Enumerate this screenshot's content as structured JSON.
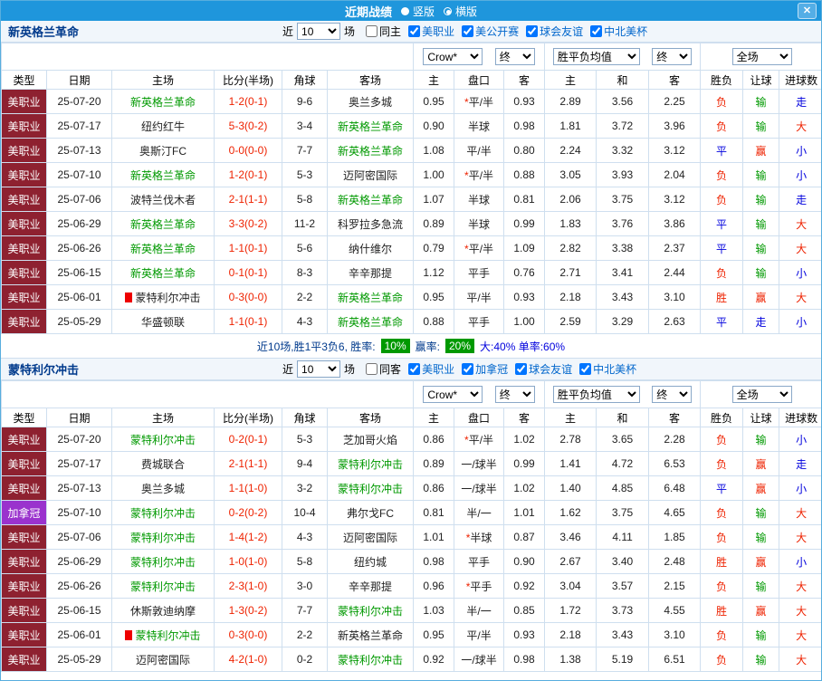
{
  "colors": {
    "topbar_bg": "#1f96dc",
    "league_mls_bg": "#8e2130",
    "league_can_bg": "#9a32cd",
    "focal_team_green": "#009900",
    "score_red": "#ee2200",
    "outcome_red": "#ee2200",
    "outcome_blue": "#0000dd",
    "outcome_green": "#009900",
    "summary_badge_bg": "#009900"
  },
  "top_bar": {
    "title": "近期战绩",
    "layout_options": [
      {
        "label": "竖版",
        "selected": false
      },
      {
        "label": "横版",
        "selected": true
      }
    ],
    "close_label": "✕"
  },
  "sections": [
    {
      "team": "新英格兰革命",
      "filter": {
        "prefix": "近",
        "count": "10",
        "suffix": "场",
        "checkboxes": [
          {
            "label": "同主",
            "checked": false,
            "blue": false
          },
          {
            "label": "美职业",
            "checked": true,
            "blue": true
          },
          {
            "label": "美公开赛",
            "checked": true,
            "blue": true
          },
          {
            "label": "球会友谊",
            "checked": true,
            "blue": true
          },
          {
            "label": "中北美杯",
            "checked": true,
            "blue": true
          }
        ]
      },
      "dropdowns": {
        "company": "Crow*",
        "company_state": "终",
        "avg_type": "胜平负均值",
        "avg_state": "终",
        "scope": "全场"
      },
      "headers": [
        "类型",
        "日期",
        "主场",
        "比分(半场)",
        "角球",
        "客场",
        "主",
        "盘口",
        "客",
        "主",
        "和",
        "客",
        "胜负",
        "让球",
        "进球数"
      ],
      "rows": [
        {
          "league": "美职业",
          "lt": "mls",
          "date": "25-07-20",
          "home": {
            "name": "新英格兰革命",
            "focal": true,
            "rc": false
          },
          "score": "1-2(0-1)",
          "corners": "9-6",
          "away": {
            "name": "奥兰多城",
            "focal": false,
            "rc": false
          },
          "o1": "0.95",
          "hc": "*平/半",
          "o2": "0.93",
          "a1": "2.89",
          "a2": "3.56",
          "a3": "2.25",
          "r1": "负",
          "r2": "输",
          "r3": "走"
        },
        {
          "league": "美职业",
          "lt": "mls",
          "date": "25-07-17",
          "home": {
            "name": "纽约红牛",
            "focal": false,
            "rc": false
          },
          "score": "5-3(0-2)",
          "corners": "3-4",
          "away": {
            "name": "新英格兰革命",
            "focal": true,
            "rc": false
          },
          "o1": "0.90",
          "hc": "半球",
          "o2": "0.98",
          "a1": "1.81",
          "a2": "3.72",
          "a3": "3.96",
          "r1": "负",
          "r2": "输",
          "r3": "大"
        },
        {
          "league": "美职业",
          "lt": "mls",
          "date": "25-07-13",
          "home": {
            "name": "奥斯汀FC",
            "focal": false,
            "rc": false
          },
          "score": "0-0(0-0)",
          "corners": "7-7",
          "away": {
            "name": "新英格兰革命",
            "focal": true,
            "rc": false
          },
          "o1": "1.08",
          "hc": "平/半",
          "o2": "0.80",
          "a1": "2.24",
          "a2": "3.32",
          "a3": "3.12",
          "r1": "平",
          "r2": "赢",
          "r3": "小"
        },
        {
          "league": "美职业",
          "lt": "mls",
          "date": "25-07-10",
          "home": {
            "name": "新英格兰革命",
            "focal": true,
            "rc": false
          },
          "score": "1-2(0-1)",
          "corners": "5-3",
          "away": {
            "name": "迈阿密国际",
            "focal": false,
            "rc": false
          },
          "o1": "1.00",
          "hc": "*平/半",
          "o2": "0.88",
          "a1": "3.05",
          "a2": "3.93",
          "a3": "2.04",
          "r1": "负",
          "r2": "输",
          "r3": "小"
        },
        {
          "league": "美职业",
          "lt": "mls",
          "date": "25-07-06",
          "home": {
            "name": "波特兰伐木者",
            "focal": false,
            "rc": false
          },
          "score": "2-1(1-1)",
          "corners": "5-8",
          "away": {
            "name": "新英格兰革命",
            "focal": true,
            "rc": false
          },
          "o1": "1.07",
          "hc": "半球",
          "o2": "0.81",
          "a1": "2.06",
          "a2": "3.75",
          "a3": "3.12",
          "r1": "负",
          "r2": "输",
          "r3": "走"
        },
        {
          "league": "美职业",
          "lt": "mls",
          "date": "25-06-29",
          "home": {
            "name": "新英格兰革命",
            "focal": true,
            "rc": false
          },
          "score": "3-3(0-2)",
          "corners": "11-2",
          "away": {
            "name": "科罗拉多急流",
            "focal": false,
            "rc": false
          },
          "o1": "0.89",
          "hc": "半球",
          "o2": "0.99",
          "a1": "1.83",
          "a2": "3.76",
          "a3": "3.86",
          "r1": "平",
          "r2": "输",
          "r3": "大"
        },
        {
          "league": "美职业",
          "lt": "mls",
          "date": "25-06-26",
          "home": {
            "name": "新英格兰革命",
            "focal": true,
            "rc": false
          },
          "score": "1-1(0-1)",
          "corners": "5-6",
          "away": {
            "name": "纳什维尔",
            "focal": false,
            "rc": false
          },
          "o1": "0.79",
          "hc": "*平/半",
          "o2": "1.09",
          "a1": "2.82",
          "a2": "3.38",
          "a3": "2.37",
          "r1": "平",
          "r2": "输",
          "r3": "大"
        },
        {
          "league": "美职业",
          "lt": "mls",
          "date": "25-06-15",
          "home": {
            "name": "新英格兰革命",
            "focal": true,
            "rc": false
          },
          "score": "0-1(0-1)",
          "corners": "8-3",
          "away": {
            "name": "辛辛那提",
            "focal": false,
            "rc": false
          },
          "o1": "1.12",
          "hc": "平手",
          "o2": "0.76",
          "a1": "2.71",
          "a2": "3.41",
          "a3": "2.44",
          "r1": "负",
          "r2": "输",
          "r3": "小"
        },
        {
          "league": "美职业",
          "lt": "mls",
          "date": "25-06-01",
          "home": {
            "name": "蒙特利尔冲击",
            "focal": false,
            "rc": true
          },
          "score": "0-3(0-0)",
          "corners": "2-2",
          "away": {
            "name": "新英格兰革命",
            "focal": true,
            "rc": false
          },
          "o1": "0.95",
          "hc": "平/半",
          "o2": "0.93",
          "a1": "2.18",
          "a2": "3.43",
          "a3": "3.10",
          "r1": "胜",
          "r2": "赢",
          "r3": "大"
        },
        {
          "league": "美职业",
          "lt": "mls",
          "date": "25-05-29",
          "home": {
            "name": "华盛顿联",
            "focal": false,
            "rc": false
          },
          "score": "1-1(0-1)",
          "corners": "4-3",
          "away": {
            "name": "新英格兰革命",
            "focal": true,
            "rc": false
          },
          "o1": "0.88",
          "hc": "平手",
          "o2": "1.00",
          "a1": "2.59",
          "a2": "3.29",
          "a3": "2.63",
          "r1": "平",
          "r2": "走",
          "r3": "小"
        }
      ],
      "summary": {
        "lead": "近10场,胜1平3负6, 胜率:",
        "win_rate": "10%",
        "mid": "赢率:",
        "handicap_rate": "20%",
        "tail": "大:40% 单率:60%"
      }
    },
    {
      "team": "蒙特利尔冲击",
      "filter": {
        "prefix": "近",
        "count": "10",
        "suffix": "场",
        "checkboxes": [
          {
            "label": "同客",
            "checked": false,
            "blue": false
          },
          {
            "label": "美职业",
            "checked": true,
            "blue": true
          },
          {
            "label": "加拿冠",
            "checked": true,
            "blue": true
          },
          {
            "label": "球会友谊",
            "checked": true,
            "blue": true
          },
          {
            "label": "中北美杯",
            "checked": true,
            "blue": true
          }
        ]
      },
      "dropdowns": {
        "company": "Crow*",
        "company_state": "终",
        "avg_type": "胜平负均值",
        "avg_state": "终",
        "scope": "全场"
      },
      "headers": [
        "类型",
        "日期",
        "主场",
        "比分(半场)",
        "角球",
        "客场",
        "主",
        "盘口",
        "客",
        "主",
        "和",
        "客",
        "胜负",
        "让球",
        "进球数"
      ],
      "rows": [
        {
          "league": "美职业",
          "lt": "mls",
          "date": "25-07-20",
          "home": {
            "name": "蒙特利尔冲击",
            "focal": true,
            "rc": false
          },
          "score": "0-2(0-1)",
          "corners": "5-3",
          "away": {
            "name": "芝加哥火焰",
            "focal": false,
            "rc": false
          },
          "o1": "0.86",
          "hc": "*平/半",
          "o2": "1.02",
          "a1": "2.78",
          "a2": "3.65",
          "a3": "2.28",
          "r1": "负",
          "r2": "输",
          "r3": "小"
        },
        {
          "league": "美职业",
          "lt": "mls",
          "date": "25-07-17",
          "home": {
            "name": "费城联合",
            "focal": false,
            "rc": false
          },
          "score": "2-1(1-1)",
          "corners": "9-4",
          "away": {
            "name": "蒙特利尔冲击",
            "focal": true,
            "rc": false
          },
          "o1": "0.89",
          "hc": "一/球半",
          "o2": "0.99",
          "a1": "1.41",
          "a2": "4.72",
          "a3": "6.53",
          "r1": "负",
          "r2": "赢",
          "r3": "走"
        },
        {
          "league": "美职业",
          "lt": "mls",
          "date": "25-07-13",
          "home": {
            "name": "奥兰多城",
            "focal": false,
            "rc": false
          },
          "score": "1-1(1-0)",
          "corners": "3-2",
          "away": {
            "name": "蒙特利尔冲击",
            "focal": true,
            "rc": false
          },
          "o1": "0.86",
          "hc": "一/球半",
          "o2": "1.02",
          "a1": "1.40",
          "a2": "4.85",
          "a3": "6.48",
          "r1": "平",
          "r2": "赢",
          "r3": "小"
        },
        {
          "league": "加拿冠",
          "lt": "can",
          "date": "25-07-10",
          "home": {
            "name": "蒙特利尔冲击",
            "focal": true,
            "rc": false
          },
          "score": "0-2(0-2)",
          "corners": "10-4",
          "away": {
            "name": "弗尔戈FC",
            "focal": false,
            "rc": false
          },
          "o1": "0.81",
          "hc": "半/一",
          "o2": "1.01",
          "a1": "1.62",
          "a2": "3.75",
          "a3": "4.65",
          "r1": "负",
          "r2": "输",
          "r3": "大"
        },
        {
          "league": "美职业",
          "lt": "mls",
          "date": "25-07-06",
          "home": {
            "name": "蒙特利尔冲击",
            "focal": true,
            "rc": false
          },
          "score": "1-4(1-2)",
          "corners": "4-3",
          "away": {
            "name": "迈阿密国际",
            "focal": false,
            "rc": false
          },
          "o1": "1.01",
          "hc": "*半球",
          "o2": "0.87",
          "a1": "3.46",
          "a2": "4.11",
          "a3": "1.85",
          "r1": "负",
          "r2": "输",
          "r3": "大"
        },
        {
          "league": "美职业",
          "lt": "mls",
          "date": "25-06-29",
          "home": {
            "name": "蒙特利尔冲击",
            "focal": true,
            "rc": false
          },
          "score": "1-0(1-0)",
          "corners": "5-8",
          "away": {
            "name": "纽约城",
            "focal": false,
            "rc": false
          },
          "o1": "0.98",
          "hc": "平手",
          "o2": "0.90",
          "a1": "2.67",
          "a2": "3.40",
          "a3": "2.48",
          "r1": "胜",
          "r2": "赢",
          "r3": "小"
        },
        {
          "league": "美职业",
          "lt": "mls",
          "date": "25-06-26",
          "home": {
            "name": "蒙特利尔冲击",
            "focal": true,
            "rc": false
          },
          "score": "2-3(1-0)",
          "corners": "3-0",
          "away": {
            "name": "辛辛那提",
            "focal": false,
            "rc": false
          },
          "o1": "0.96",
          "hc": "*平手",
          "o2": "0.92",
          "a1": "3.04",
          "a2": "3.57",
          "a3": "2.15",
          "r1": "负",
          "r2": "输",
          "r3": "大"
        },
        {
          "league": "美职业",
          "lt": "mls",
          "date": "25-06-15",
          "home": {
            "name": "休斯敦迪纳摩",
            "focal": false,
            "rc": false
          },
          "score": "1-3(0-2)",
          "corners": "7-7",
          "away": {
            "name": "蒙特利尔冲击",
            "focal": true,
            "rc": false
          },
          "o1": "1.03",
          "hc": "半/一",
          "o2": "0.85",
          "a1": "1.72",
          "a2": "3.73",
          "a3": "4.55",
          "r1": "胜",
          "r2": "赢",
          "r3": "大"
        },
        {
          "league": "美职业",
          "lt": "mls",
          "date": "25-06-01",
          "home": {
            "name": "蒙特利尔冲击",
            "focal": true,
            "rc": true
          },
          "score": "0-3(0-0)",
          "corners": "2-2",
          "away": {
            "name": "新英格兰革命",
            "focal": false,
            "rc": false
          },
          "o1": "0.95",
          "hc": "平/半",
          "o2": "0.93",
          "a1": "2.18",
          "a2": "3.43",
          "a3": "3.10",
          "r1": "负",
          "r2": "输",
          "r3": "大"
        },
        {
          "league": "美职业",
          "lt": "mls",
          "date": "25-05-29",
          "home": {
            "name": "迈阿密国际",
            "focal": false,
            "rc": false
          },
          "score": "4-2(1-0)",
          "corners": "0-2",
          "away": {
            "name": "蒙特利尔冲击",
            "focal": true,
            "rc": false
          },
          "o1": "0.92",
          "hc": "一/球半",
          "o2": "0.98",
          "a1": "1.38",
          "a2": "5.19",
          "a3": "6.51",
          "r1": "负",
          "r2": "输",
          "r3": "大"
        }
      ]
    }
  ]
}
